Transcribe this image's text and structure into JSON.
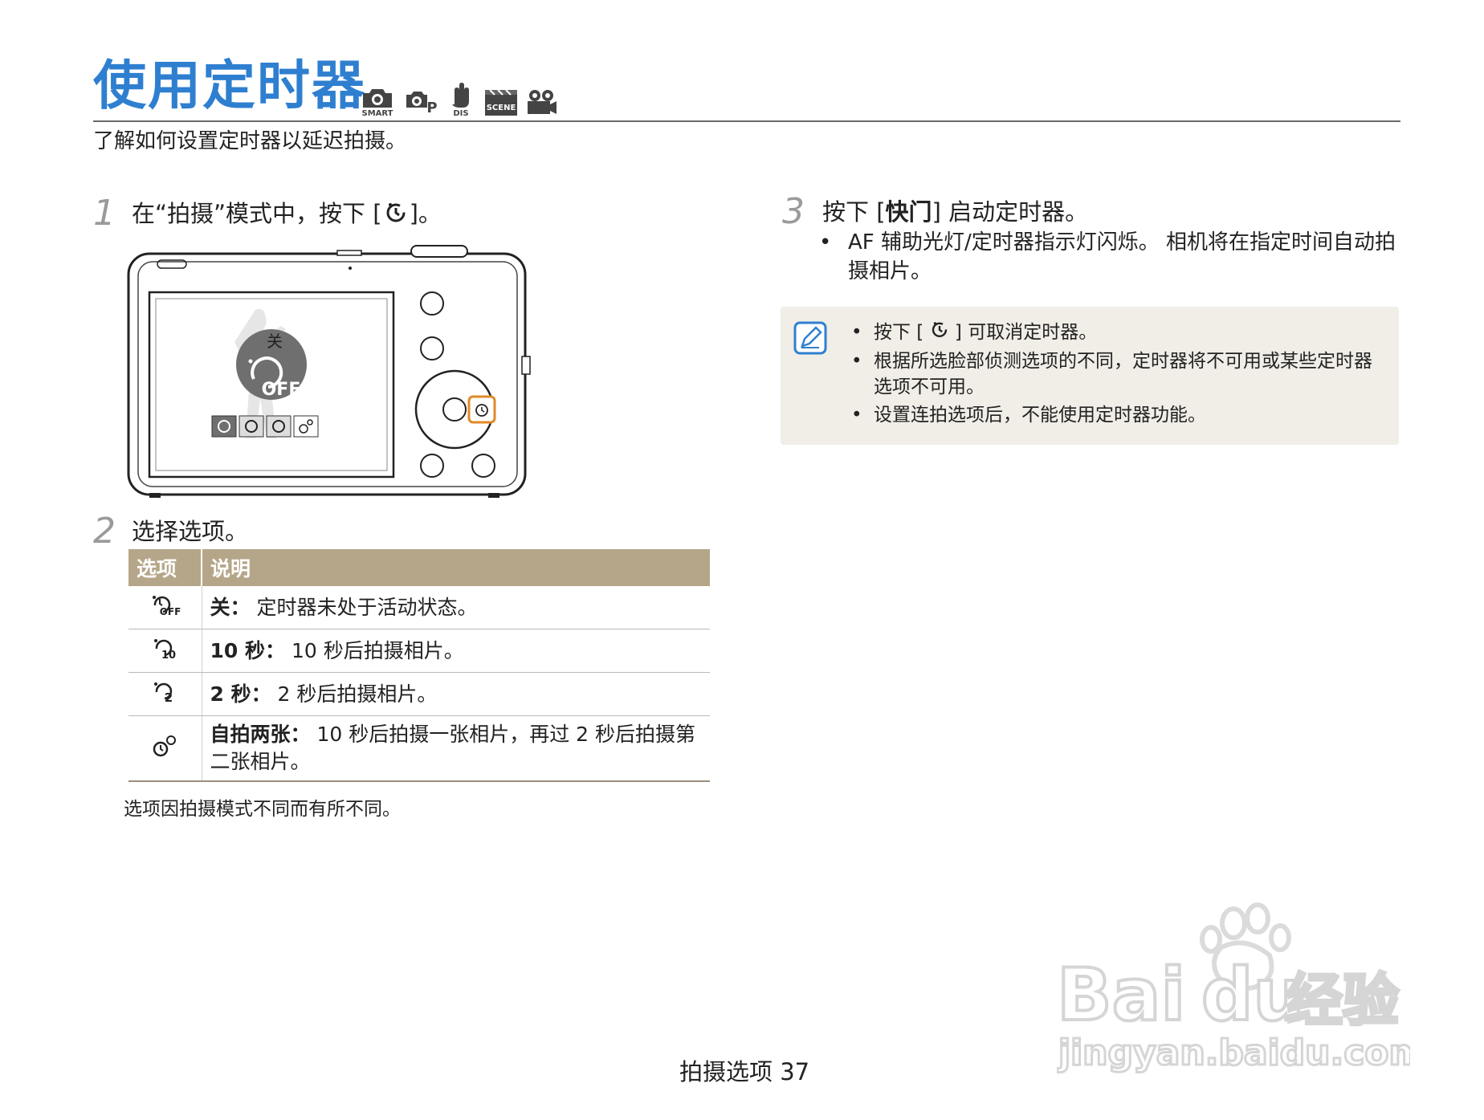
{
  "header": {
    "title": "使用定时器",
    "mode_icons": [
      {
        "name": "smart-auto-icon",
        "caption": "SMART"
      },
      {
        "name": "program-icon",
        "caption": "P"
      },
      {
        "name": "dual-is-icon",
        "caption": "DIS"
      },
      {
        "name": "scene-icon",
        "caption": "SCENE"
      },
      {
        "name": "movie-icon",
        "caption": ""
      }
    ],
    "intro": "了解如何设置定时器以延迟拍摄。"
  },
  "step1": {
    "num": "1",
    "text_before": "在“拍摄”模式中，按下 [",
    "text_after": "]。"
  },
  "camera": {
    "screen_label": "关",
    "screen_big_icon_text": "OFF"
  },
  "step2": {
    "num": "2",
    "text": "选择选项。"
  },
  "options_table": {
    "headers": [
      "选项",
      "说明"
    ],
    "rows": [
      {
        "icon": "timer-off-icon",
        "term": "关：",
        "desc": " 定时器未处于活动状态。"
      },
      {
        "icon": "timer-10s-icon",
        "term": "10 秒：",
        "desc": "  10 秒后拍摄相片。"
      },
      {
        "icon": "timer-2s-icon",
        "term": "2 秒：",
        "desc": "  2 秒后拍摄相片。"
      },
      {
        "icon": "double-timer-icon",
        "term": "自拍两张：",
        "desc": "  10 秒后拍摄一张相片，再过 2 秒后拍摄第二张相片。"
      }
    ]
  },
  "table_note": "选项因拍摄模式不同而有所不同。",
  "step3": {
    "num": "3",
    "text_before": "按下 [",
    "bold": "快门",
    "text_after": "] 启动定时器。",
    "bullet": "AF 辅助光灯/定时器指示灯闪烁。 相机将在指定时间自动拍摄相片。"
  },
  "note": {
    "icon": "note-pencil-icon",
    "items": [
      {
        "before": "按下 [",
        "after": "] 可取消定时器。"
      },
      {
        "before": "根据所选脸部侦测选项的不同，定时器将不可用或某些定时器选项不可用。",
        "after": ""
      },
      {
        "before": "设置连拍选项后，不能使用定时器功能。",
        "after": ""
      }
    ]
  },
  "footer": {
    "section": "拍摄选项",
    "page": "37"
  },
  "watermark": {
    "brand_a": "Bai",
    "brand_b": "du",
    "brand_c": "经验",
    "url": "jingyan.baidu.com"
  },
  "colors": {
    "title_blue": "#2f7fd0",
    "table_header": "#b6a689",
    "note_bg": "#f1ede7",
    "highlight_orange": "#e08a28"
  }
}
